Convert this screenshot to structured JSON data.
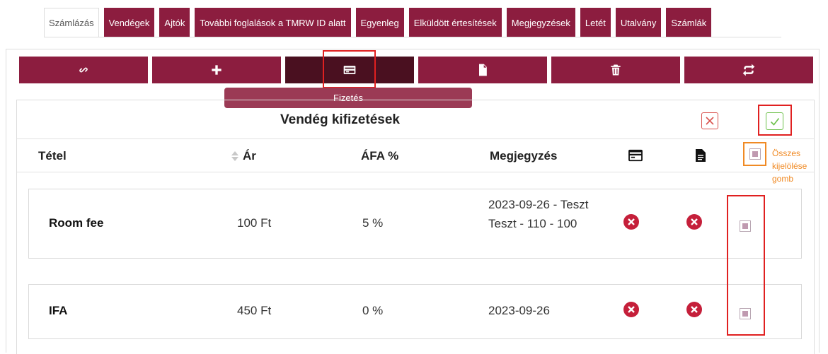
{
  "tabs": [
    {
      "label": "Számlázás",
      "active": true
    },
    {
      "label": "Vendégek"
    },
    {
      "label": "Ajtók"
    },
    {
      "label": "További foglalások a TMRW ID alatt"
    },
    {
      "label": "Egyenleg"
    },
    {
      "label": "Elküldött értesítések"
    },
    {
      "label": "Megjegyzések"
    },
    {
      "label": "Letét"
    },
    {
      "label": "Utalvány"
    },
    {
      "label": "Számlák"
    }
  ],
  "toolbar": {
    "buttons": [
      "link-icon",
      "plus-icon",
      "credit-card-icon",
      "invoice-icon",
      "trash-icon",
      "exchange-icon"
    ],
    "active_index": 2,
    "tooltip": "Fizetés"
  },
  "section": {
    "title": "Vendég kifizetések"
  },
  "table": {
    "headers": {
      "item": "Tétel",
      "price": "Ár",
      "vat": "ÁFA %",
      "note": "Megjegyzés"
    },
    "rows": [
      {
        "item": "Room fee",
        "price": "100 Ft",
        "vat": "5 %",
        "note": "2023-09-26 - Teszt Teszt - 110 - 100"
      },
      {
        "item": "IFA",
        "price": "450 Ft",
        "vat": "0 %",
        "note": "2023-09-26"
      }
    ]
  },
  "annotation": "Összes kijelölése gomb",
  "colors": {
    "brand": "#8c1d3f",
    "brand_dark": "#4a1020",
    "highlight_red": "#e02020",
    "highlight_orange": "#f08a24",
    "status_x": "#c51f3a",
    "confirm_green": "#6cc04a"
  }
}
